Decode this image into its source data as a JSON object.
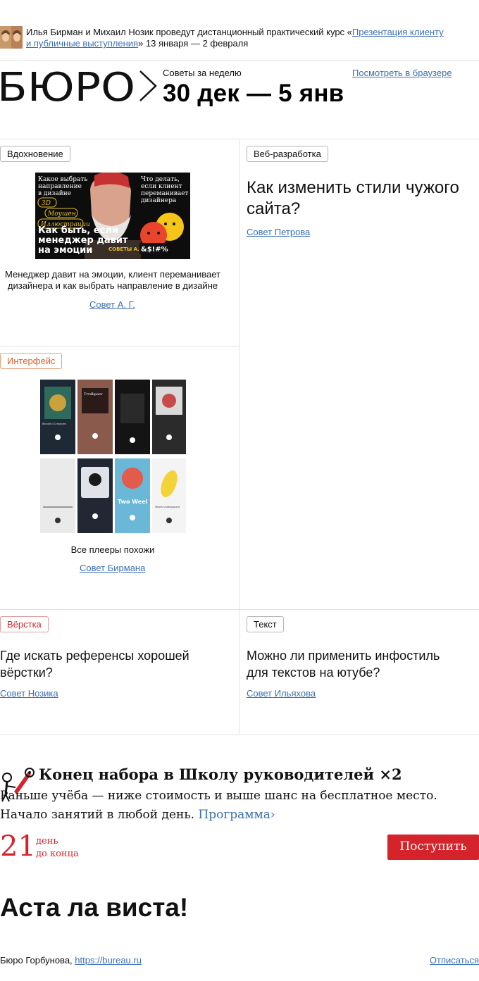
{
  "announcement": {
    "prefix": "Илья Бирман и Михаил Нозик проведут дистанционный практический курс «",
    "course_link": "Презентация клиенту и публичные выступления",
    "suffix": "» 13 января — 2 февраля"
  },
  "header": {
    "logo_text": "БЮРО",
    "label": "Советы за неделю",
    "date_range": "30 дек — 5 янв",
    "browser_link": "Посмотреть в браузере"
  },
  "cards": [
    {
      "tag": "Вдохновение",
      "image": {
        "lines_left": [
          "Какое выбрать",
          "направление",
          "в дизайне"
        ],
        "lines_right": [
          "Что делать,",
          "если клиент",
          "переманивает",
          "дизайнера"
        ],
        "box1": "3D",
        "box2": "Моушен",
        "box3": "Иллюстрации",
        "headline": "Как быть, если менеджер давит на эмоции",
        "badge": "СОВЕТЫ А. Г.",
        "curse": "&$!#%"
      },
      "caption": "Менеджер давит на эмоции, клиент переманивает дизайнера и как выбрать направление в дизайне",
      "advice": "Совет А. Г."
    },
    {
      "tag": "Веб-разработка",
      "title": "Как изменить стили чужого сайта?",
      "advice": "Совет Петрова"
    },
    {
      "tag": "Интерфейс",
      "image": {
        "screen_texts": [
          "Beautiful Creatures",
          "Trvdhpaer",
          "Two Weel",
          "Velvet Underground"
        ]
      },
      "caption": "Все плееры похожи",
      "advice": "Совет Бирмана"
    },
    {
      "tag": "Вёрстка",
      "title": "Где искать референсы хорошей вёрстки?",
      "advice": "Совет Нозика"
    },
    {
      "tag": "Текст",
      "title": "Можно ли применить инфостиль для текстов на ютубе?",
      "advice": "Совет Ильяхова"
    }
  ],
  "promo": {
    "title": "Конец набора в Школу руководителей",
    "multiplier": "×2",
    "line1": "Раньше учёба — ниже стоимость и выше шанс на бесплатное место.",
    "line2": "Начало занятий в любой день.",
    "program_link": "Программа",
    "days_number": "21",
    "days_word": "день",
    "days_suffix": "до конца",
    "button": "Поступить"
  },
  "farewell": "Аста ла виста!",
  "footer": {
    "company": "Бюро Горбунова,",
    "site": "https://bureau.ru",
    "unsubscribe": "Отписаться"
  },
  "colors": {
    "link": "#3a6fb0",
    "accent_red": "#d4232a",
    "tag_orange": "#e06020",
    "divider": "#e2e2e2"
  }
}
